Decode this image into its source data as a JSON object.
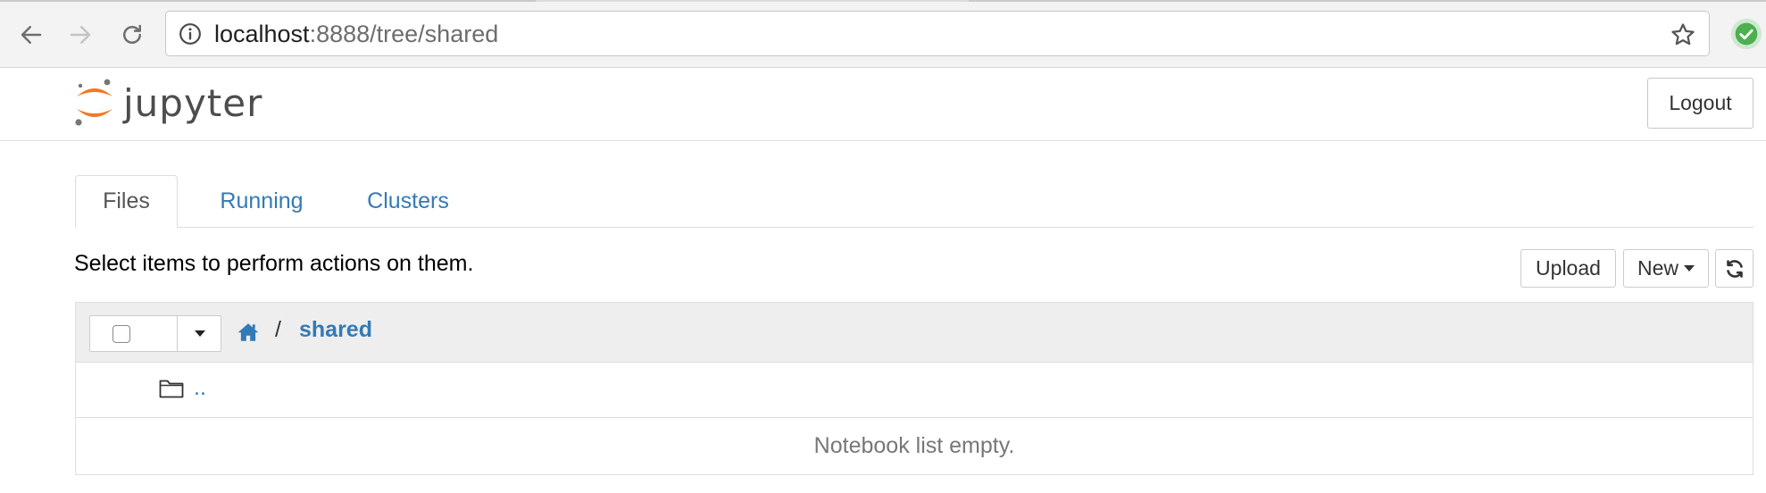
{
  "browser": {
    "url_host": "localhost",
    "url_rest": ":8888/tree/shared",
    "icons": [
      "back-arrow-icon",
      "forward-arrow-icon",
      "reload-icon",
      "info-icon",
      "star-icon",
      "extension-check-icon"
    ]
  },
  "header": {
    "logo_text": "jupyter",
    "logout_label": "Logout"
  },
  "tabs": [
    {
      "label": "Files",
      "active": true
    },
    {
      "label": "Running",
      "active": false
    },
    {
      "label": "Clusters",
      "active": false
    }
  ],
  "toolbar": {
    "hint": "Select items to perform actions on them.",
    "upload_label": "Upload",
    "new_label": "New"
  },
  "breadcrumb": {
    "separator": "/",
    "current": "shared"
  },
  "list": {
    "parent_link": "..",
    "empty_message": "Notebook list empty."
  },
  "colors": {
    "link": "#337ab7",
    "logo_orange": "#f37726",
    "logo_gray": "#767677",
    "ext_green": "#4caf50"
  }
}
